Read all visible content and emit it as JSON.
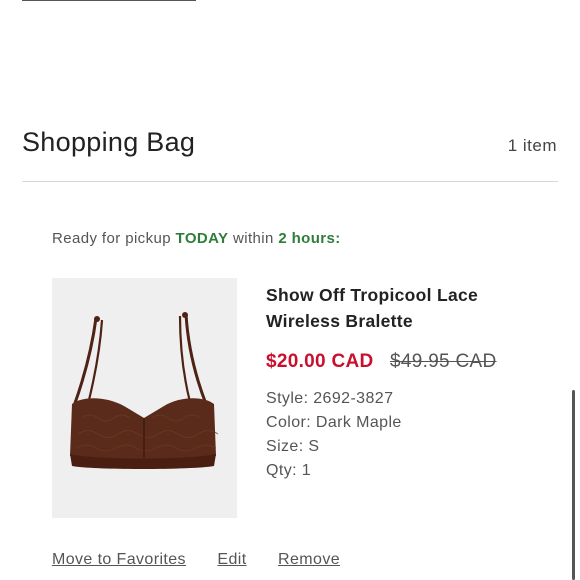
{
  "bag": {
    "title": "Shopping Bag",
    "count": "1 item"
  },
  "pickup": {
    "prefix": "Ready for pickup",
    "today": "TODAY",
    "within": "within",
    "window": "2 hours:"
  },
  "item": {
    "name": "Show Off Tropicool Lace Wireless Bralette",
    "sale_price": "$20.00 CAD",
    "original_price": "$49.95 CAD",
    "style": "Style: 2692-3827",
    "color": "Color: Dark Maple",
    "size": "Size: S",
    "qty": "Qty: 1",
    "image_color": "#5a2a1a"
  },
  "actions": {
    "favorites": "Move to Favorites",
    "edit": "Edit",
    "remove": "Remove"
  },
  "colors": {
    "sale": "#c8102e",
    "pickup_highlight": "#2e7d3b"
  }
}
